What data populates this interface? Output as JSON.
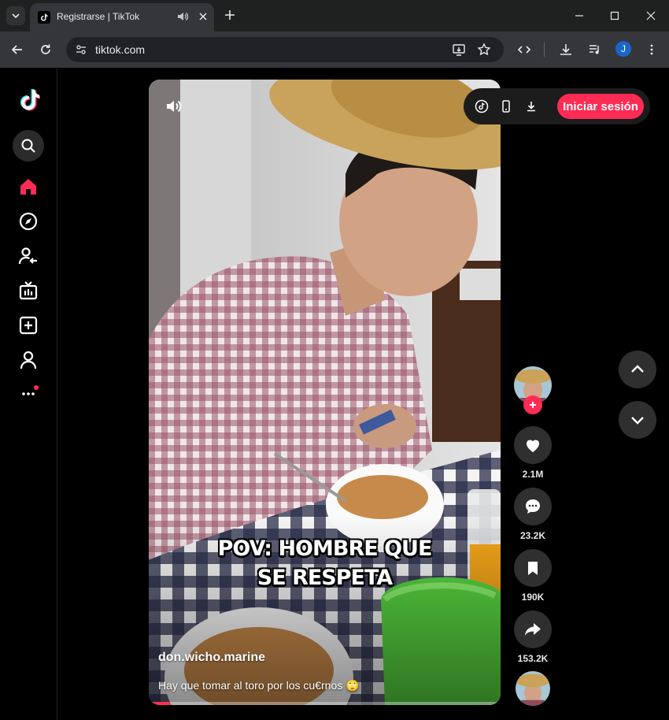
{
  "browser": {
    "tab_title": "Registrarse | TikTok",
    "url": "tiktok.com",
    "profile_initial": "J"
  },
  "sidebar": {
    "items": [
      {
        "name": "search",
        "icon": "search-icon"
      },
      {
        "name": "home",
        "icon": "home-icon",
        "active": true
      },
      {
        "name": "explore",
        "icon": "compass-icon"
      },
      {
        "name": "following",
        "icon": "following-icon"
      },
      {
        "name": "live",
        "icon": "live-tv-icon"
      },
      {
        "name": "upload",
        "icon": "plus-square-icon"
      },
      {
        "name": "profile",
        "icon": "profile-icon"
      },
      {
        "name": "more",
        "icon": "more-icon"
      }
    ]
  },
  "video": {
    "caption_line1": "POV: HOMBRE QUE",
    "caption_line2": "SE RESPETA",
    "username": "don.wicho.marine",
    "description": "Hay que tomar al toro por los cu€rnos 🙄",
    "progress": 0.06
  },
  "top_bar": {
    "login_label": "Iniciar sesión"
  },
  "actions": {
    "likes": "2.1M",
    "comments": "23.2K",
    "saves": "190K",
    "shares": "153.2K"
  },
  "colors": {
    "accent": "#fe2c55",
    "background": "#000000",
    "chrome_toolbar": "#35363a"
  }
}
